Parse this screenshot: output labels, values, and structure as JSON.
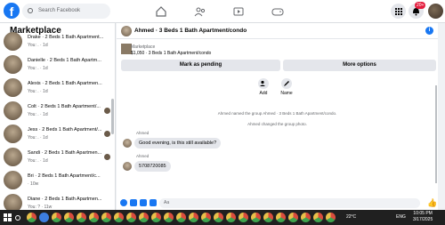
{
  "topbar": {
    "logo": "f",
    "search_placeholder": "Search Facebook",
    "notification_badge": "20+",
    "icons": [
      "home-icon",
      "friends-icon",
      "watch-icon",
      "gaming-icon",
      "menu-grid-icon",
      "messenger-icon",
      "notifications-icon"
    ]
  },
  "sidebar": {
    "title": "Marketplace",
    "back": "←",
    "conversations": [
      {
        "name": "Drake · 2 Beds 1 Bath Apartment...",
        "sub": "You: . · 1d"
      },
      {
        "name": "Danielle · 2 Beds 1 Bath Apartm...",
        "sub": "You: . · 1d"
      },
      {
        "name": "Alexis · 2 Beds 1 Bath Apartmen...",
        "sub": "You: . · 1d"
      },
      {
        "name": "Colt · 2 Beds 1 Bath Apartment/...",
        "sub": "You: . · 1d"
      },
      {
        "name": "Jess · 2 Beds 1 Bath Apartment/...",
        "sub": "You: . · 1d"
      },
      {
        "name": "Sandi · 2 Beds 1 Bath Apartmen...",
        "sub": "You: . · 1d"
      },
      {
        "name": "Bri · 2 Beds 1 Bath Apartment/c...",
        "sub": "· 10w"
      },
      {
        "name": "Diane · 2 Beds 1 Bath Apartmen...",
        "sub": "You: ? · 11w"
      }
    ]
  },
  "chat": {
    "title": "Ahmed · 3 Beds 1 Bath Apartment/condo",
    "info": "i",
    "listing_label": "Marketplace",
    "listing_price": "$1,050 · 3 Beds 1 Bath Apartment/condo",
    "mark_pending": "Mark as pending",
    "more_options": "More options",
    "add_label": "Add",
    "name_label": "Name",
    "system_1": "Ahmed named the group Ahmed · 3 Beds 1 Bath Apartment/condo.",
    "system_2": "Ahmed changed the group photo.",
    "messages": [
      {
        "sender": "Ahmed",
        "text": "Good evening, is this still available?"
      },
      {
        "sender": "Ahmed",
        "text": "5708720085"
      }
    ],
    "composer_placeholder": "Aa",
    "like": "👍"
  },
  "taskbar": {
    "weather": "22°C",
    "lang": "ENG",
    "time": "10:05 PM",
    "date": "3/17/2025"
  }
}
